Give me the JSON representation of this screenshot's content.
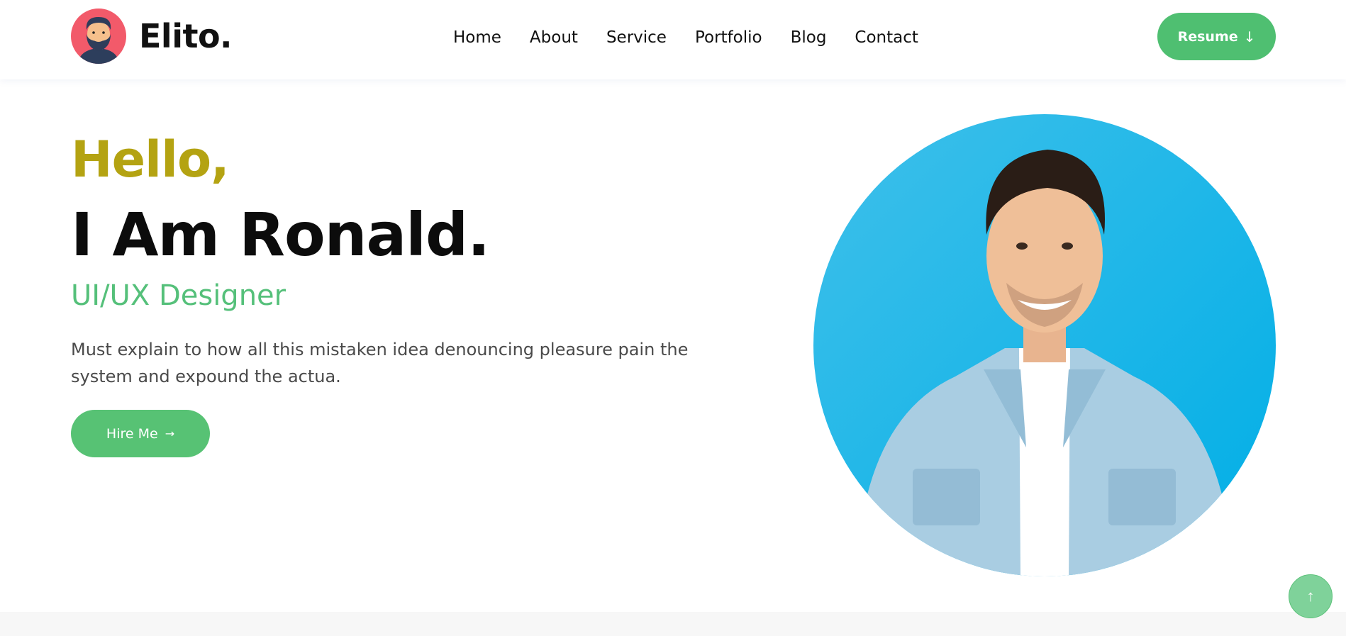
{
  "header": {
    "brand": "Elito.",
    "logo_icon": "bearded-man-avatar-icon",
    "nav": [
      "Home",
      "About",
      "Service",
      "Portfolio",
      "Blog",
      "Contact"
    ],
    "resume_label": "Resume",
    "resume_icon": "arrow-down-icon"
  },
  "hero": {
    "greeting": "Hello,",
    "name": "I Am Ronald.",
    "role": "UI/UX Designer",
    "description": "Must explain to how all this mistaken idea denouncing pleasure pain the system and expound the actua.",
    "hire_label": "Hire Me",
    "hire_icon": "arrow-right-icon",
    "portrait": "smiling-man-denim-shirt-photo"
  },
  "scroll_top_icon": "arrow-up-icon",
  "colors": {
    "accent_green": "#55c07a",
    "greeting_olive": "#b4a312",
    "portrait_bg": "#1bb0e4",
    "logo_bg": "#f25a6a"
  }
}
